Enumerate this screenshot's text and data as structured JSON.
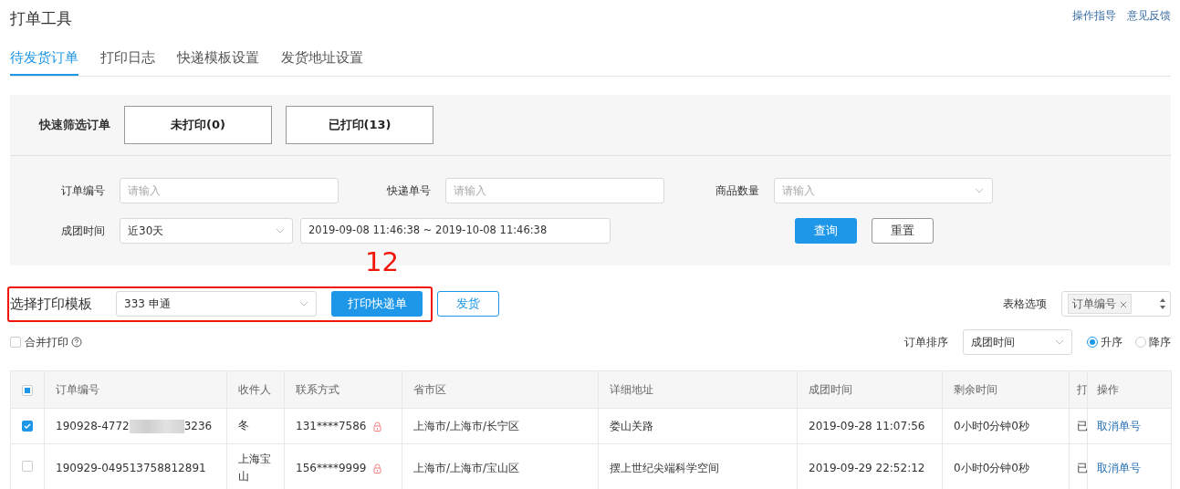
{
  "title": "打单工具",
  "header_links": [
    "操作指导",
    "意见反馈"
  ],
  "tabs": [
    {
      "label": "待发货订单",
      "selected": true
    },
    {
      "label": "打印日志",
      "selected": false
    },
    {
      "label": "快递模板设置",
      "selected": false
    },
    {
      "label": "发货地址设置",
      "selected": false
    }
  ],
  "quick_filter": {
    "label": "快速筛选订单",
    "buttons": [
      "未打印(0)",
      "已打印(13)"
    ]
  },
  "filters": [
    {
      "label": "订单编号",
      "kind": "input",
      "placeholder": "请输入"
    },
    {
      "label": "快递单号",
      "kind": "input",
      "placeholder": "请输入"
    },
    {
      "label": "商品数量",
      "kind": "select",
      "placeholder": "请输入"
    }
  ],
  "time_filter": {
    "label": "成团时间",
    "preset": "近30天",
    "range": "2019-09-08 11:46:38 ~ 2019-10-08 11:46:38"
  },
  "actions": [
    "查询",
    "重置"
  ],
  "annotation": {
    "label": "12"
  },
  "template": {
    "label": "选择打印模板",
    "value": "333 申通",
    "print_button": "打印快递单",
    "ship_button": "发货"
  },
  "table_options": {
    "label": "表格选项",
    "tags": [
      "订单编号"
    ]
  },
  "merge_print": {
    "label": "合并打印",
    "checked": false
  },
  "sort": {
    "label": "订单排序",
    "value": "成团时间",
    "options": [
      {
        "label": "升序",
        "selected": true
      },
      {
        "label": "降序",
        "selected": false
      }
    ]
  },
  "table": {
    "header_indeterminate": true,
    "columns": [
      "订单编号",
      "收件人",
      "联系方式",
      "省市区",
      "详细地址",
      "成团时间",
      "剩余时间",
      "打",
      "操作"
    ],
    "rows": [
      {
        "selected": true,
        "order_no": "190928-4772",
        "order_no_tail": "3236",
        "recipient": "冬",
        "phone": "131****7586",
        "region": "上海市/上海市/长宁区",
        "address": "娄山关路",
        "time": "2019-09-28 11:07:56",
        "remaining": "0小时0分钟0秒",
        "print_status": "已",
        "action": "取消单号"
      },
      {
        "selected": false,
        "order_no": "190929-049513758812891",
        "recipient": "上海宝山",
        "phone": "156****9999",
        "region": "上海市/上海市/宝山区",
        "address": "摆上世纪尖端科学空间",
        "time": "2019-09-29 22:52:12",
        "remaining": "0小时0分钟0秒",
        "print_status": "已",
        "action": "取消单号"
      }
    ]
  }
}
